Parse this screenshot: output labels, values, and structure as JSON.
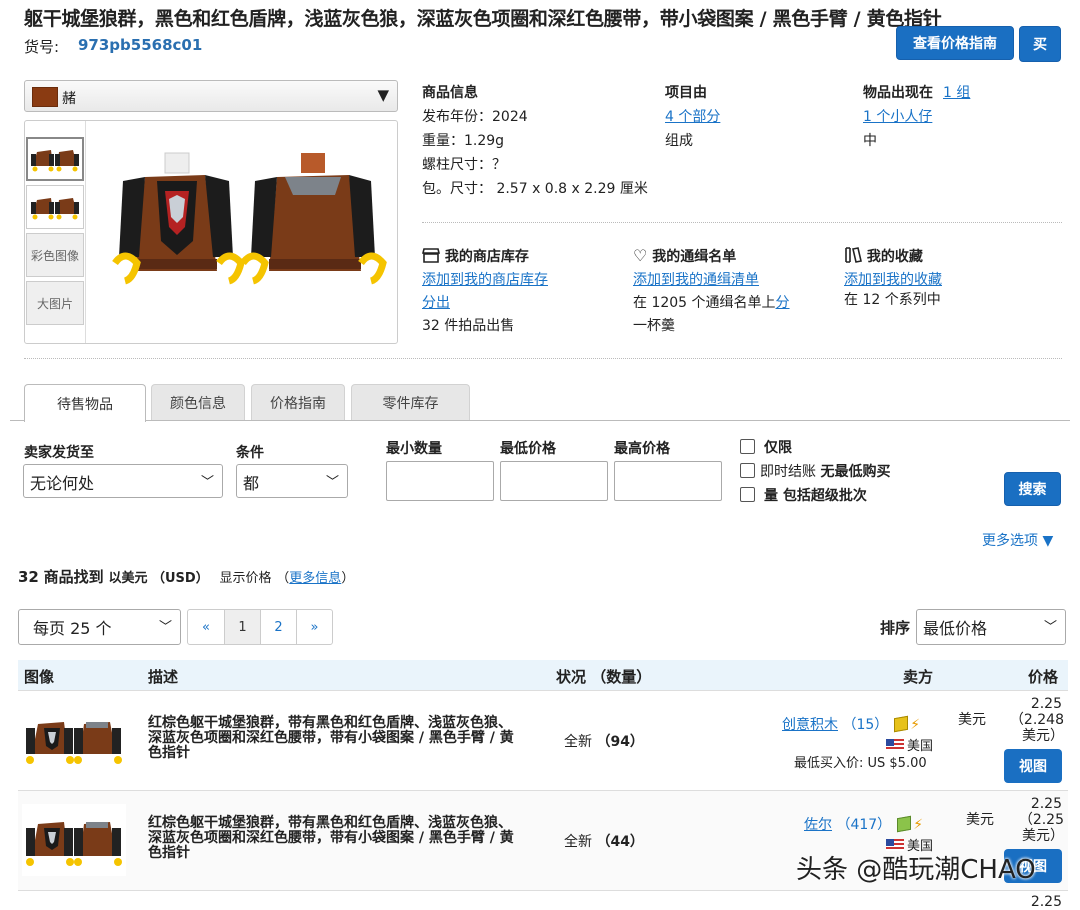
{
  "header": {
    "title": "躯干城堡狼群，黑色和红色盾牌，浅蓝灰色狼，深蓝灰色项圈和深红色腰带，带小袋图案 / 黑色手臂 / 黄色指针",
    "item_no_label": "货号:",
    "item_no": "973pb5568c01",
    "price_guide_button": "查看价格指南",
    "buy_button": "买"
  },
  "color_select": {
    "value": "赭",
    "swatch": "#8a3b12"
  },
  "thumbs": {
    "color_image": "彩色图像",
    "large_image": "大图片"
  },
  "info": {
    "product_info_title": "商品信息",
    "year": "发布年份：2024",
    "weight": "重量：1.29g",
    "stud": "螺柱尺寸：？",
    "pack": "包。尺寸：  2.57 x 0.8 x 2.29 厘米",
    "consists_title": "项目由",
    "parts_link": "4 个部分",
    "composed": "组成",
    "appears_title": "物品出现在",
    "appears_link": "1 组",
    "minifig_link": "1 个小人仔",
    "in": "中"
  },
  "store": {
    "title": "我的商店库存",
    "add_link": "添加到我的商店库存",
    "split_link": "分出",
    "lots": "32 件拍品出售"
  },
  "wanted": {
    "title": "我的通缉名单",
    "add_link": "添加到我的通缉清单",
    "on_lists": "在 1205 个通缉名单上",
    "on_lists_link": "分",
    "cup": "一杯羹"
  },
  "collection": {
    "title": "我的收藏",
    "add_link": "添加到我的收藏",
    "in_sets": "在 12 个系列中"
  },
  "tabs": [
    "待售物品",
    "颜色信息",
    "价格指南",
    "零件库存"
  ],
  "filters": {
    "ships_to_label": "卖家发货至",
    "ships_to_value": "无论何处",
    "condition_label": "条件",
    "condition_value": "都",
    "min_qty_label": "最小数量",
    "min_price_label": "最低价格",
    "max_price_label": "最高价格",
    "only": "仅限",
    "instant_checkout": "即时结账",
    "no_min_buy": "无最低购买",
    "qty": "量",
    "include_bulk": "包括超级批次",
    "search_button": "搜索",
    "more_options": "更多选项 ▼"
  },
  "results": {
    "count": "32",
    "found": "商品找到",
    "in_usd": "以美元 （USD）",
    "show_price": "显示价格",
    "paren_open": "（",
    "more_info": "更多信息",
    "paren_close": "）"
  },
  "pagination": {
    "per_page": "每页 25 个",
    "first": "«",
    "pages": [
      "1",
      "2"
    ],
    "last": "»",
    "sort_label": "排序",
    "sort_value": "最低价格"
  },
  "table": {
    "headers": {
      "image": "图像",
      "desc": "描述",
      "cond": "状况 （数量）",
      "seller": "卖方",
      "price": "价格"
    },
    "rows": [
      {
        "desc": "红棕色躯干城堡狼群，带有黑色和红色盾牌、浅蓝灰色狼、深蓝灰色项圈和深红色腰带，带有小袋图案 / 黑色手臂 / 黄色指针",
        "cond": "全新",
        "qty": "（94）",
        "seller": "创意积木",
        "seller_count": "（15）",
        "country": "美国",
        "min_buy": "最低买入价:  US $5.00",
        "price_main": "2.25",
        "price_cur": "美元",
        "price_alt": "（2.248 美元）",
        "view": "视图"
      },
      {
        "desc": "红棕色躯干城堡狼群，带有黑色和红色盾牌、浅蓝灰色狼、深蓝灰色项圈和深红色腰带，带有小袋图案 / 黑色手臂 / 黄色指针",
        "cond": "全新",
        "qty": "（44）",
        "seller": "佐尔",
        "seller_count": "（417）",
        "country": "美国",
        "price_main": "2.25",
        "price_cur": "美元",
        "price_alt": "（2.25 美元）",
        "view": "视图"
      }
    ],
    "next_price": "2.25"
  },
  "watermark": "头条 @酷玩潮CHAO"
}
